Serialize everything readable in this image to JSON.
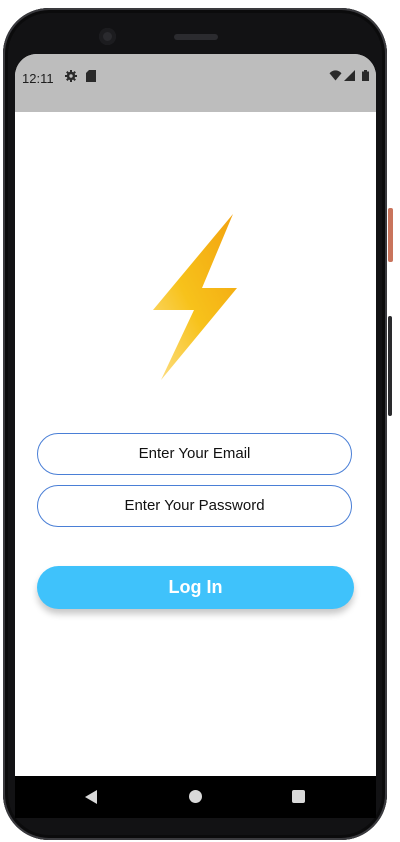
{
  "status_bar": {
    "time": "12:11",
    "left_icons": [
      "settings-gear-icon",
      "sd-card-icon"
    ],
    "right_icons": [
      "wifi-icon",
      "cell-signal-icon",
      "battery-icon"
    ]
  },
  "app": {
    "logo_icon": "lightning-bolt-icon",
    "email_placeholder": "Enter Your Email",
    "password_placeholder": "Enter Your Password",
    "login_label": "Log In"
  },
  "navigation": {
    "back_icon": "back-triangle-icon",
    "home_icon": "home-circle-icon",
    "recents_icon": "recents-square-icon"
  },
  "colors": {
    "status_bar": "#bdbdbd",
    "input_border": "#4a7fd6",
    "login_button": "#3fc2fb",
    "bolt_dark": "#f2a20f",
    "bolt_light": "#fde08a"
  }
}
